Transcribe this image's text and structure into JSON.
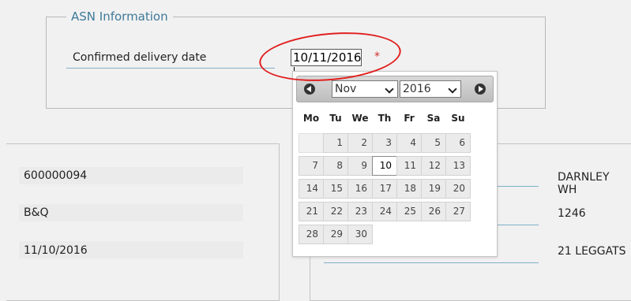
{
  "asn": {
    "legend": "ASN Information",
    "field_label": "Confirmed delivery date",
    "date_value": "10/11/2016",
    "required_mark": "*"
  },
  "calendar": {
    "month": "Nov",
    "year": "2016",
    "weekdays": [
      "Mo",
      "Tu",
      "We",
      "Th",
      "Fr",
      "Sa",
      "Su"
    ],
    "weeks": [
      [
        "",
        "1",
        "2",
        "3",
        "4",
        "5",
        "6"
      ],
      [
        "7",
        "8",
        "9",
        "10",
        "11",
        "12",
        "13"
      ],
      [
        "14",
        "15",
        "16",
        "17",
        "18",
        "19",
        "20"
      ],
      [
        "21",
        "22",
        "23",
        "24",
        "25",
        "26",
        "27"
      ],
      [
        "28",
        "29",
        "30"
      ]
    ],
    "selected_day": "10"
  },
  "left_panel": {
    "rows": [
      "600000094",
      "B&Q",
      "11/10/2016"
    ]
  },
  "right_panel": {
    "rows": [
      "DARNLEY WH",
      "1246",
      "21 LEGGATS"
    ]
  },
  "colors": {
    "accent": "#3e7a9a",
    "highlight_ring": "#e11f1f",
    "required": "#d42b2b"
  }
}
